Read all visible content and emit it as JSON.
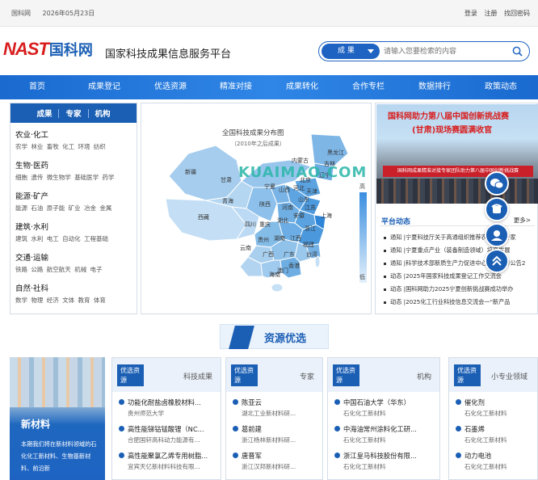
{
  "topbar": {
    "site": "国科网",
    "date": "2026年05月23日",
    "login": "登录",
    "register": "注册",
    "forgot": "找回密码"
  },
  "header": {
    "logo_latin": "NAST",
    "logo_cn": "国科网",
    "slogan": "国家科技成果信息服务平台"
  },
  "search": {
    "category": "成 果",
    "placeholder": "请输入您要检索的内容"
  },
  "nav": [
    "首页",
    "成果登记",
    "优选资源",
    "精准对接",
    "成果转化",
    "合作专栏",
    "数据排行",
    "政策动态"
  ],
  "categories": {
    "tabs": [
      "成果",
      "专家",
      "机构"
    ],
    "groups": [
      {
        "title": "农业·化工",
        "subs": "农学 林业 畜牧 化工 环境 纺织"
      },
      {
        "title": "生物·医药",
        "subs": "细胞 遗传 微生物学 基础医学 药学"
      },
      {
        "title": "能源·矿产",
        "subs": "能源 石油 原子能 矿业 冶金 金属"
      },
      {
        "title": "建筑·水利",
        "subs": "建筑 水利 电工 自动化 工程基础"
      },
      {
        "title": "交通·运输",
        "subs": "铁路 公路 航空航天 机械 电子"
      },
      {
        "title": "自然·社科",
        "subs": "数学 物理 经济 文体 教育 体育"
      }
    ]
  },
  "map": {
    "title": "全国科技成果分布图",
    "subtitle": "（2010年之后成果）",
    "legend_high": "高",
    "legend_low": "低",
    "labels": [
      "黑龙江",
      "吉林",
      "内蒙古",
      "辽宁",
      "新疆",
      "甘肃",
      "宁夏",
      "山西",
      "河北",
      "北京",
      "天津",
      "山东",
      "青海",
      "陕西",
      "河南",
      "江苏",
      "西藏",
      "四川",
      "湖北",
      "安徽",
      "上海",
      "重庆",
      "浙江",
      "贵州",
      "湖南",
      "江西",
      "福建",
      "云南",
      "广西",
      "广东",
      "台湾",
      "香港",
      "澳门",
      "海南"
    ]
  },
  "watermark": "KUAIMAO.COM",
  "news": {
    "banner_line1": "国科网助力第八届中国创新挑战赛",
    "banner_line2": "(甘肃)现场赛圆满收官",
    "banner_red": "国科网成果精准对接专家团队助力第八届中国创新挑战赛",
    "heading": "平台动态",
    "more": "更多>",
    "items": [
      "通知 |宁夏科技厅关于高通组织推荐农业科技专家",
      "通知 |宁夏重点产业（装备制造领域）培育发展",
      "通知 |科学技术部新质生产力促进中心工作指导公告2",
      "动态 |2025年国家科技成果登记工作交流会",
      "动态 |国科网助力2025宁夏创新挑战赛成功举办",
      "动态 |2025化工行业科技信息交流会一\"新产品"
    ]
  },
  "section": {
    "title": "资源优选"
  },
  "featured": {
    "title": "新材料",
    "desc": "本期我们将在新材料领域的石化化工新材料、生物基新材料、前沿新"
  },
  "cards": [
    {
      "tag": "优选资源",
      "title": "科技成果",
      "rows": [
        {
          "main": "功能化耐盐卤橡胶材料...",
          "sub": "贵州师范大学"
        },
        {
          "main": "高性能锑钴锰酸锂（NC...",
          "sub": "合肥国轩高科动力能源有..."
        },
        {
          "main": "高性能聚氯乙烯专用树脂...",
          "sub": "宜宾天亿新材料科技有限..."
        }
      ]
    },
    {
      "tag": "优选资源",
      "title": "专家",
      "rows": [
        {
          "main": "陈亚云",
          "sub": "湖北工业新材料研..."
        },
        {
          "main": "葛前建",
          "sub": "浙江杨林新材料研..."
        },
        {
          "main": "唐晋军",
          "sub": "浙江汉邦新材料研..."
        }
      ]
    },
    {
      "tag": "优选资源",
      "title": "机构",
      "rows": [
        {
          "main": "中国石油大学（华东）",
          "sub": "石化化工新材料"
        },
        {
          "main": "中海油常州涂料化工研...",
          "sub": "石化化工新材料"
        },
        {
          "main": "浙江皇马科技股份有限...",
          "sub": "石化化工新材料"
        }
      ]
    },
    {
      "tag": "优选资源",
      "title": "小专业领域",
      "rows": [
        {
          "main": "催化剂",
          "sub": "石化化工新材料"
        },
        {
          "main": "石墨烯",
          "sub": "石化化工新材料"
        },
        {
          "main": "动力电池",
          "sub": "石化化工新材料"
        }
      ]
    }
  ],
  "colors": {
    "brand_blue": "#1b5fb5",
    "logo_red": "#d81e1e"
  },
  "floating_icons": [
    "wechat-icon",
    "phone-icon",
    "service-icon",
    "back-to-top-icon"
  ]
}
